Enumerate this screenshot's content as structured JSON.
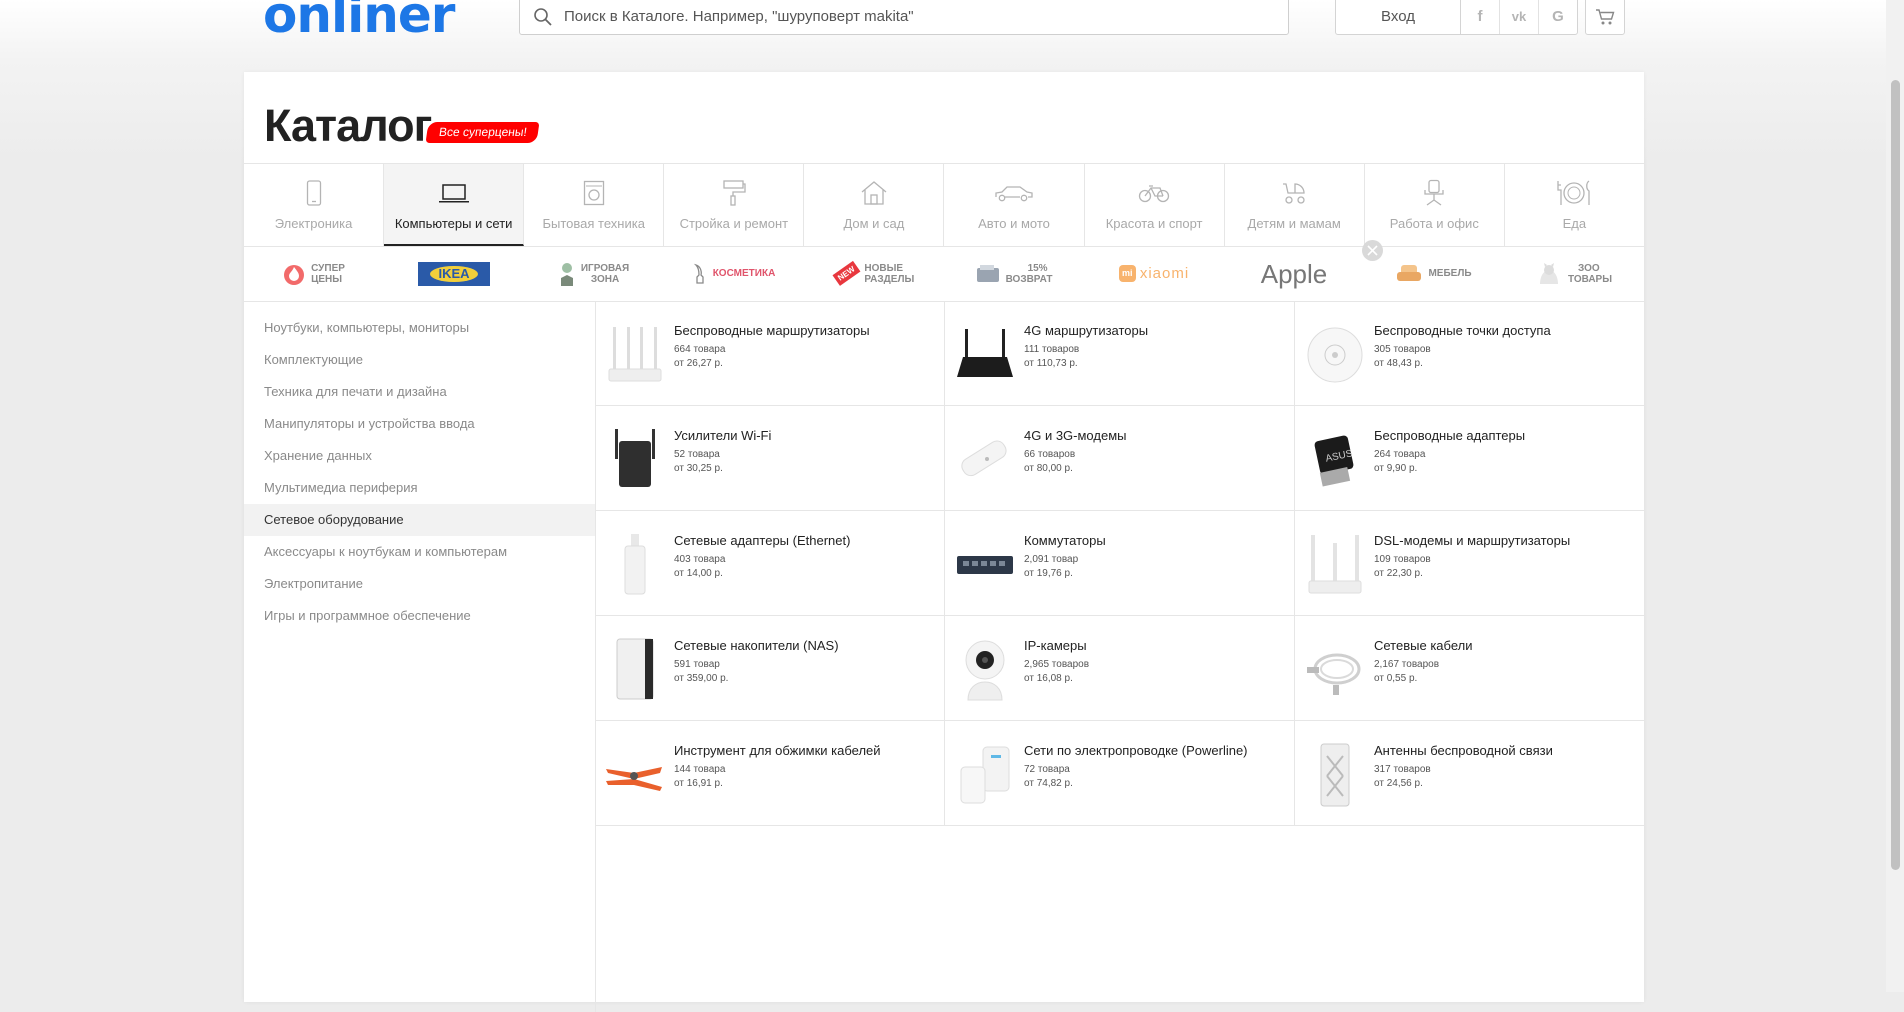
{
  "header": {
    "logo": "onliner",
    "search_placeholder": "Поиск в Каталоге. Например, \"шуруповерт makita\"",
    "login_label": "Вход",
    "social": [
      "f",
      "vk",
      "G"
    ]
  },
  "catalog": {
    "title": "Каталог",
    "promo_badge": "Все суперцены!"
  },
  "tabs": [
    {
      "label": "Электроника",
      "icon": "smartphone-icon"
    },
    {
      "label": "Компьютеры и сети",
      "icon": "laptop-icon"
    },
    {
      "label": "Бытовая техника",
      "icon": "washing-machine-icon"
    },
    {
      "label": "Стройка и ремонт",
      "icon": "paint-roller-icon"
    },
    {
      "label": "Дом и сад",
      "icon": "house-icon"
    },
    {
      "label": "Авто и мото",
      "icon": "car-icon"
    },
    {
      "label": "Красота и спорт",
      "icon": "bicycle-icon"
    },
    {
      "label": "Детям и мамам",
      "icon": "stroller-icon"
    },
    {
      "label": "Работа и офис",
      "icon": "office-chair-icon"
    },
    {
      "label": "Еда",
      "icon": "plate-cutlery-icon"
    }
  ],
  "brands": {
    "super_prices": [
      "СУПЕР",
      "ЦЕНЫ"
    ],
    "ikea": "IKEA",
    "gaming": [
      "ИГРОВАЯ",
      "ЗОНА"
    ],
    "cosmetics": "КОСМЕТИКА",
    "new_sections": [
      "НОВЫЕ",
      "РАЗДЕЛЫ"
    ],
    "new_badge": "NEW",
    "returns": [
      "15%",
      "ВОЗВРАТ"
    ],
    "xiaomi": "xiaomi",
    "apple": "Apple",
    "furniture": "МЕБЕЛЬ",
    "zoo": [
      "ЗОО",
      "ТОВАРЫ"
    ]
  },
  "sidebar": {
    "items": [
      "Ноутбуки, компьютеры, мониторы",
      "Комплектующие",
      "Техника для печати и дизайна",
      "Манипуляторы и устройства ввода",
      "Хранение данных",
      "Мультимедиа периферия",
      "Сетевое оборудование",
      "Аксессуары к ноутбукам и компьютерам",
      "Электропитание",
      "Игры и программное обеспечение"
    ],
    "active_index": 6
  },
  "products": [
    {
      "name": "Беспроводные маршрутизаторы",
      "count": "664 товара",
      "price": "от 26,27 р.",
      "icon": "router-white-icon"
    },
    {
      "name": "4G маршрутизаторы",
      "count": "111 товаров",
      "price": "от 110,73 р.",
      "icon": "router-black-icon"
    },
    {
      "name": "Беспроводные точки доступа",
      "count": "305 товаров",
      "price": "от 48,43 р.",
      "icon": "access-point-icon"
    },
    {
      "name": "Усилители Wi-Fi",
      "count": "52 товара",
      "price": "от 30,25 р.",
      "icon": "wifi-extender-icon"
    },
    {
      "name": "4G и 3G-модемы",
      "count": "66 товаров",
      "price": "от 80,00 р.",
      "icon": "usb-modem-icon"
    },
    {
      "name": "Беспроводные адаптеры",
      "count": "264 товара",
      "price": "от 9,90 р.",
      "icon": "usb-adapter-icon"
    },
    {
      "name": "Сетевые адаптеры (Ethernet)",
      "count": "403 товара",
      "price": "от 14,00 р.",
      "icon": "ethernet-adapter-icon"
    },
    {
      "name": "Коммутаторы",
      "count": "2,091 товар",
      "price": "от 19,76 р.",
      "icon": "network-switch-icon"
    },
    {
      "name": "DSL-модемы и маршрутизаторы",
      "count": "109 товаров",
      "price": "от 22,30 р.",
      "icon": "dsl-router-icon"
    },
    {
      "name": "Сетевые накопители (NAS)",
      "count": "591 товар",
      "price": "от 359,00 р.",
      "icon": "nas-icon"
    },
    {
      "name": "IP-камеры",
      "count": "2,965 товаров",
      "price": "от 16,08 р.",
      "icon": "ip-camera-icon"
    },
    {
      "name": "Сетевые кабели",
      "count": "2,167 товаров",
      "price": "от 0,55 р.",
      "icon": "network-cable-icon"
    },
    {
      "name": "Инструмент для обжимки кабелей",
      "count": "144 товара",
      "price": "от 16,91 р.",
      "icon": "crimping-tool-icon"
    },
    {
      "name": "Сети по электропроводке (Powerline)",
      "count": "72 товара",
      "price": "от 74,82 р.",
      "icon": "powerline-adapter-icon"
    },
    {
      "name": "Антенны беспроводной связи",
      "count": "317 товаров",
      "price": "от 24,56 р.",
      "icon": "antenna-icon"
    }
  ],
  "colors": {
    "brand": "#1d77e6",
    "promo": "#ff0000",
    "text_muted": "#8a8a8a"
  }
}
